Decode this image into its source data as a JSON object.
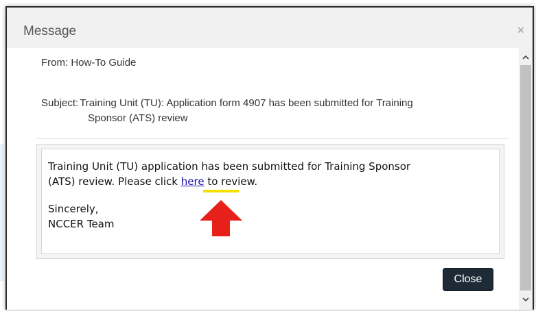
{
  "dialog": {
    "title": "Message",
    "close_icon": "×"
  },
  "message": {
    "from_label": "From:",
    "from_value": "How-To Guide",
    "subject_label": "Subject:",
    "subject_line1": "Training Unit (TU): Application form 4907 has been submitted for Training",
    "subject_line2": "Sponsor (ATS) review",
    "body_line1": "Training Unit (TU) application has been submitted for Training Sponsor",
    "body_line2_before": "(ATS) review. Please click ",
    "body_link": "here",
    "body_line2_after": " to review.",
    "signoff": "Sincerely,",
    "signature": "NCCER Team"
  },
  "buttons": {
    "close_label": "Close"
  },
  "scrollbar": {
    "up_icon": "chevron-up-icon",
    "down_icon": "chevron-down-icon"
  },
  "annotation": {
    "arrow_icon": "red-arrow-up-icon",
    "arrow_color": "#e8201a",
    "highlight_color": "#f4e100"
  }
}
